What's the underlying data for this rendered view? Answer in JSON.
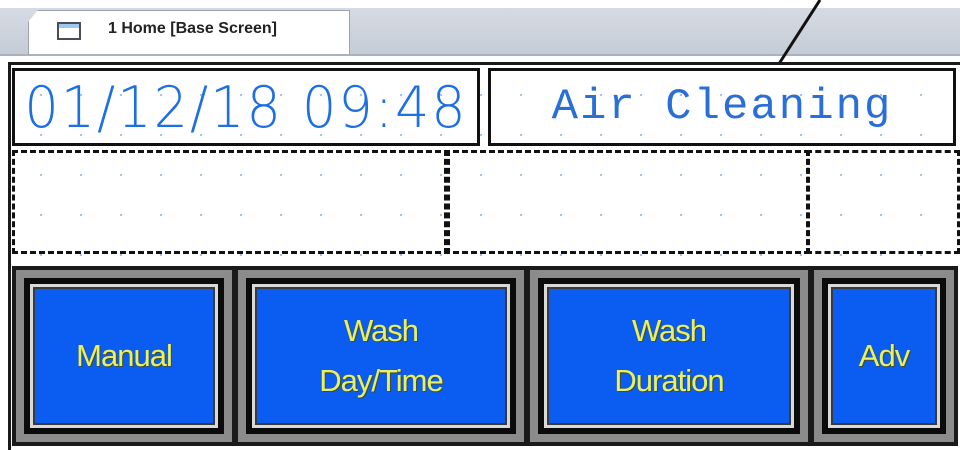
{
  "tab": {
    "label": "1 Home [Base Screen]"
  },
  "display": {
    "datetime": "01/12/18 09:48",
    "status": "Air Cleaning"
  },
  "buttons": [
    {
      "label": "Manual"
    },
    {
      "label": "Wash\nDay/Time"
    },
    {
      "label": "Wash\nDuration"
    },
    {
      "label": "Adv"
    }
  ],
  "colors": {
    "button_face": "#0a5df0",
    "button_text": "#e6f06a",
    "display_text": "#1e6fe0"
  }
}
